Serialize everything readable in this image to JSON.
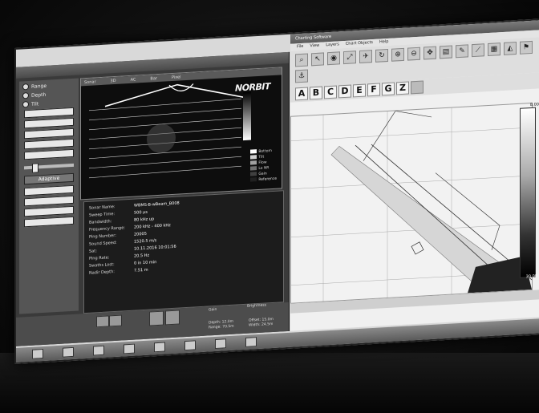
{
  "left_app": {
    "modes": [
      "Range",
      "Depth",
      "Tilt"
    ],
    "sonar_tabs": [
      "Sonar",
      "Mode",
      "3D",
      "AC",
      "Bar",
      "Wide",
      "Pixel",
      "Hilite"
    ],
    "logo": "NORBIT",
    "adaptive_label": "Adaptive",
    "legend": [
      {
        "label": "Bottom",
        "color": "#ffffff"
      },
      {
        "label": "Tilt",
        "color": "#d0d0d0"
      },
      {
        "label": "Flow",
        "color": "#a0a0a0"
      },
      {
        "label": "Lo NR",
        "color": "#707070"
      },
      {
        "label": "Gain",
        "color": "#404040"
      },
      {
        "label": "Reference",
        "color": "#202020"
      }
    ],
    "info": [
      {
        "k": "Sonar Name:",
        "v": "WBMS-B-wBeam_B008"
      },
      {
        "k": "Sweep Time:",
        "v": "500 µs"
      },
      {
        "k": "Bandwidth:",
        "v": "80 kHz up"
      },
      {
        "k": "Frequency Range:",
        "v": "200 kHz - 400 kHz"
      },
      {
        "k": "Ping Number:",
        "v": "20005"
      },
      {
        "k": "Sound Speed:",
        "v": "1520.5 m/s"
      },
      {
        "k": "Sat:",
        "v": "10.11.2016 10:01:56"
      },
      {
        "k": "Ping Rate:",
        "v": "20.5 Hz"
      },
      {
        "k": "Swaths Lost:",
        "v": "0 in 10 min"
      },
      {
        "k": "Nadir Depth:",
        "v": "7.51 m"
      }
    ],
    "gain_label": "Gain",
    "brightness_label": "Brightness",
    "readouts": [
      "Depth: 12.0m",
      "Range: 70.5m",
      "Offset: 15.0m",
      "Width: 24.5m"
    ]
  },
  "right_app": {
    "title": "Charting Software",
    "menu": [
      "File",
      "View",
      "Layers",
      "Chart Objects",
      "Help"
    ],
    "letters": [
      "A",
      "B",
      "C",
      "D",
      "E",
      "F",
      "G",
      "Z"
    ],
    "scale_top": "8.00",
    "scale_bottom": "30.00",
    "tool_icons": [
      "search-icon",
      "zoom-in-icon",
      "zoom-out-icon",
      "pan-icon",
      "measure-icon",
      "route-icon",
      "rotate-icon",
      "layers-icon"
    ]
  }
}
